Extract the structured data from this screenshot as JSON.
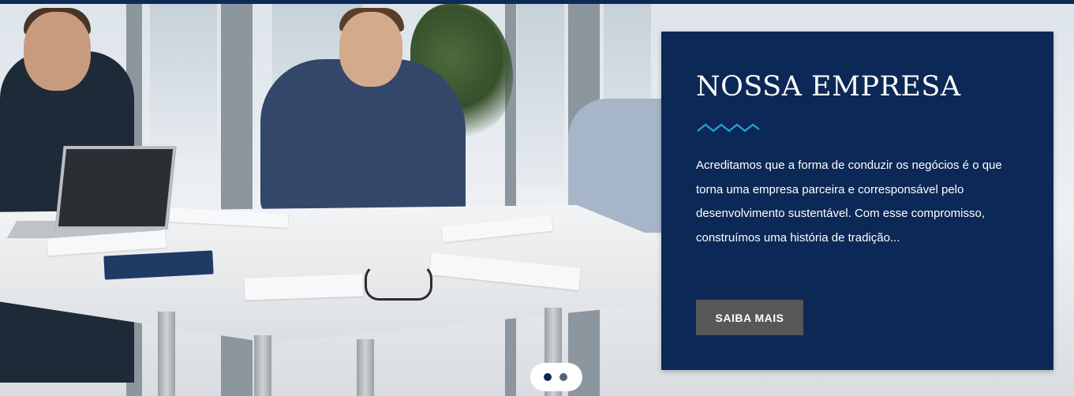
{
  "colors": {
    "top_bar": "#0e2a57",
    "card_background": "#0c2856",
    "accent_wave": "#2aa3d6",
    "button_background": "#575757",
    "pager_background": "#ffffff"
  },
  "hero": {
    "image_subject": "business-meeting-photo"
  },
  "info_card": {
    "title": "NOSSA EMPRESA",
    "divider_icon": "wave-icon",
    "body": "Acreditamos que a forma de conduzir os negócios é o que torna uma empresa parceira e corresponsável pelo desenvolvimento sustentável. Com esse compromisso, construímos uma história de tradição...",
    "button_label": "SAIBA MAIS"
  },
  "slider": {
    "slide_count": 2,
    "active_slide": 1
  }
}
